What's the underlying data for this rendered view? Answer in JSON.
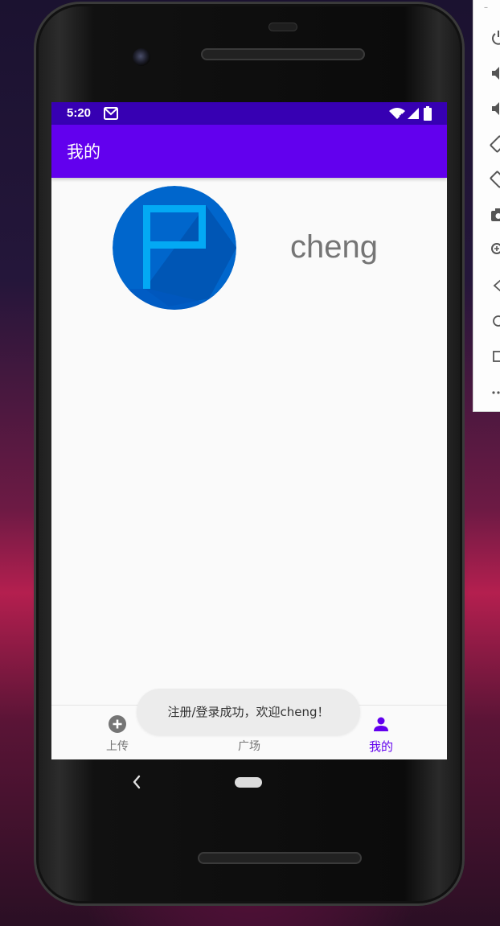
{
  "status_bar": {
    "time": "5:20"
  },
  "app_bar": {
    "title": "我的"
  },
  "profile": {
    "username": "cheng"
  },
  "bottom_nav": {
    "items": [
      {
        "label": "上传",
        "icon": "add-circle-icon",
        "active": false
      },
      {
        "label": "广场",
        "icon": "video-library-icon",
        "active": false
      },
      {
        "label": "我的",
        "icon": "person-icon",
        "active": true
      }
    ]
  },
  "toast": {
    "message": "注册/登录成功，欢迎cheng！"
  },
  "colors": {
    "status_bar": "#3700b3",
    "primary": "#6200ee",
    "avatar_bg": "#0066cc",
    "avatar_flag": "#03a9f4"
  },
  "emulator_toolbar": {
    "icons": [
      "power-icon",
      "volume-up-icon",
      "volume-down-icon",
      "rotate-left-icon",
      "rotate-right-icon",
      "camera-icon",
      "zoom-icon",
      "back-icon",
      "home-icon",
      "overview-icon",
      "more-icon"
    ]
  }
}
